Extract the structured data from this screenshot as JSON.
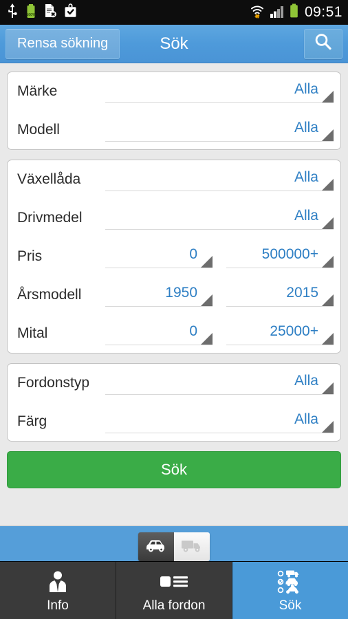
{
  "statusbar": {
    "time": "09:51",
    "battery_pct": "100%",
    "left_icons": [
      "usb-icon",
      "battery-charging-icon",
      "document-error-icon",
      "briefcase-check-icon"
    ],
    "right_icons": [
      "wifi-transfer-icon",
      "signal-bars-icon",
      "battery-icon"
    ]
  },
  "titlebar": {
    "clear_label": "Rensa sökning",
    "title": "Sök",
    "search_icon": "magnifier-icon"
  },
  "groups": [
    {
      "name": "vehicle-identity",
      "rows": [
        {
          "label": "Märke",
          "values": [
            "Alla"
          ]
        },
        {
          "label": "Modell",
          "values": [
            "Alla"
          ]
        }
      ]
    },
    {
      "name": "vehicle-specs",
      "rows": [
        {
          "label": "Växellåda",
          "values": [
            "Alla"
          ]
        },
        {
          "label": "Drivmedel",
          "values": [
            "Alla"
          ]
        },
        {
          "label": "Pris",
          "values": [
            "0",
            "500000+"
          ]
        },
        {
          "label": "Årsmodell",
          "values": [
            "1950",
            "2015"
          ]
        },
        {
          "label": "Mital",
          "values": [
            "0",
            "25000+"
          ]
        }
      ]
    },
    {
      "name": "vehicle-appearance",
      "rows": [
        {
          "label": "Fordonstyp",
          "values": [
            "Alla"
          ]
        },
        {
          "label": "Färg",
          "values": [
            "Alla"
          ]
        }
      ]
    }
  ],
  "search_cta": {
    "label": "Sök"
  },
  "vehicle_toggle": {
    "options": [
      {
        "name": "car",
        "icon": "car-icon",
        "selected": true
      },
      {
        "name": "truck",
        "icon": "truck-icon",
        "selected": false
      }
    ]
  },
  "tabbar": {
    "tabs": [
      {
        "label": "Info",
        "icon": "person-tie-icon",
        "active": false
      },
      {
        "label": "Alla fordon",
        "icon": "list-view-icon",
        "active": false
      },
      {
        "label": "Sök",
        "icon": "vehicle-list-icon",
        "active": true
      }
    ]
  },
  "colors": {
    "header_blue": "#4e9ada",
    "accent_blue": "#2e7fc4",
    "cta_green": "#3aac47",
    "page_bg": "#e9e9e9",
    "tab_dark": "#3a3a3a"
  }
}
